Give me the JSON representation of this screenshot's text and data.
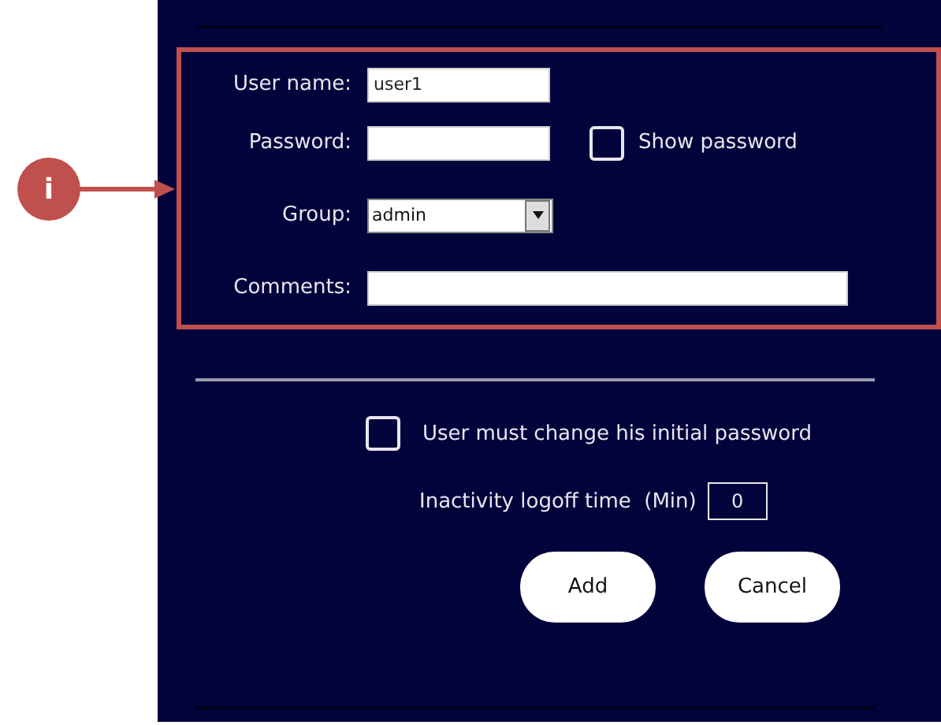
{
  "callout": {
    "label": "i"
  },
  "fields": [
    {
      "kind": "text",
      "label": "User name:",
      "value": "user1"
    },
    {
      "kind": "password",
      "label": "Password:",
      "option": {
        "label": "Show password",
        "checked": false
      }
    },
    {
      "kind": "select",
      "label": "Group:",
      "value": "admin"
    },
    {
      "kind": "wide",
      "label": "Comments:"
    }
  ],
  "must_change": {
    "label": "User must change his initial password",
    "checked": false
  },
  "inactivity": {
    "label": "Inactivity logoff time  (Min)",
    "value": "0"
  },
  "buttons": [
    "Add",
    "Cancel"
  ]
}
